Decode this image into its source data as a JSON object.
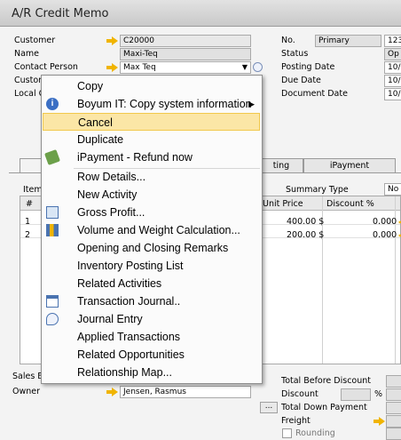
{
  "window": {
    "title": "A/R Credit Memo"
  },
  "header_left": {
    "customer_label": "Customer",
    "customer_value": "C20000",
    "name_label": "Name",
    "name_value": "Maxi-Teq",
    "contact_label": "Contact Person",
    "contact_value": "Max Teq",
    "custref_label": "Custor",
    "local_label": "Local C"
  },
  "header_right": {
    "no_label": "No.",
    "no_series": "Primary",
    "no_value": "123",
    "status_label": "Status",
    "status_value": "Op",
    "posting_label": "Posting Date",
    "posting_value": "10/",
    "due_label": "Due Date",
    "due_value": "10/",
    "doc_label": "Document Date",
    "doc_value": "10/"
  },
  "tabs": {
    "ting": "ting",
    "ipayment": "iPayment"
  },
  "items": {
    "item_label": "Item",
    "summary_type_label": "Summary Type",
    "summary_type_value": "No",
    "col_hash": "#",
    "col_unit_price": "Unit Price",
    "col_discount": "Discount %",
    "rows": [
      {
        "num": "1",
        "price": "400.00 $",
        "discount": "0.000"
      },
      {
        "num": "2",
        "price": "200.00 $",
        "discount": "0.000"
      }
    ]
  },
  "footer": {
    "sales_label": "Sales E",
    "owner_label": "Owner",
    "owner_value": "Jensen, Rasmus",
    "total_before_discount": "Total Before Discount",
    "discount": "Discount",
    "pct": "%",
    "total_down_payment": "Total Down Payment",
    "freight": "Freight",
    "rounding": "Rounding",
    "ellipsis_btn": "..."
  },
  "context_menu": {
    "copy": "Copy",
    "boyum": "Boyum IT: Copy system information",
    "cancel": "Cancel",
    "duplicate": "Duplicate",
    "ipayment_refund": "iPayment - Refund now",
    "row_details": "Row Details...",
    "new_activity": "New Activity",
    "gross_profit": "Gross Profit...",
    "volume_weight": "Volume and Weight Calculation...",
    "opening_closing": "Opening and Closing Remarks",
    "inventory_posting": "Inventory Posting List",
    "related_activities": "Related Activities",
    "transaction_journal": "Transaction Journal..",
    "journal_entry": "Journal Entry",
    "applied_transactions": "Applied Transactions",
    "related_opportunities": "Related Opportunities",
    "relationship_map": "Relationship Map..."
  },
  "colors": {
    "highlight": "#fbe6a6",
    "arrow": "#f0b400"
  }
}
